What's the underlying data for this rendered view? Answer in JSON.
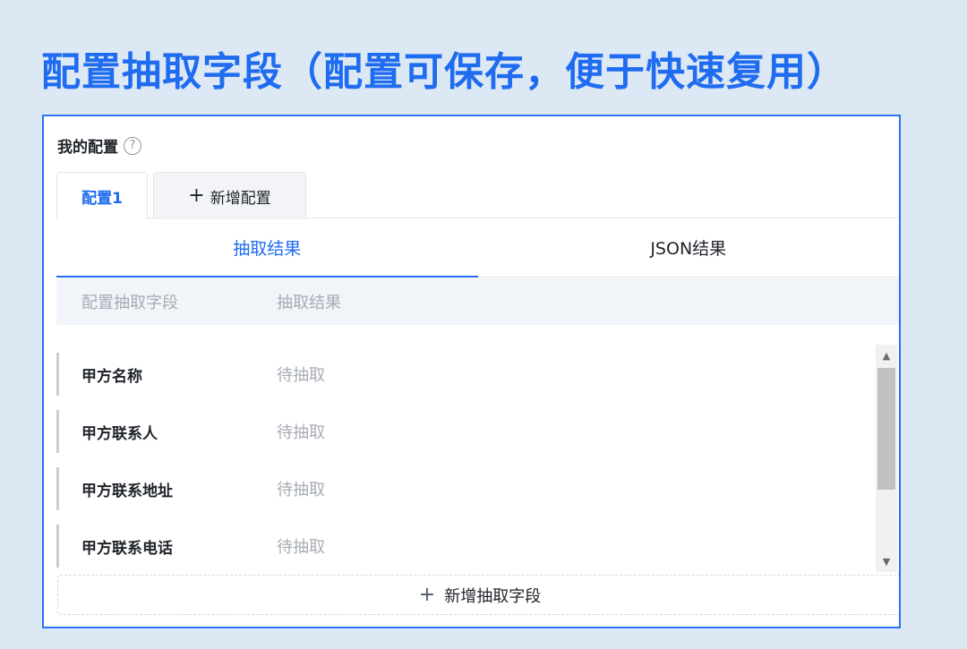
{
  "headline": "配置抽取字段（配置可保存，便于快速复用）",
  "panel": {
    "my_config_label": "我的配置",
    "help_glyph": "?",
    "config_tabs": [
      {
        "label": "配置1",
        "active": true
      },
      {
        "label": "新增配置",
        "icon": "plus-icon"
      }
    ],
    "result_tabs": [
      {
        "label": "抽取结果",
        "active": true
      },
      {
        "label": "JSON结果"
      }
    ],
    "table": {
      "columns": [
        "配置抽取字段",
        "抽取结果"
      ],
      "rows": [
        {
          "field": "甲方名称",
          "value": "待抽取"
        },
        {
          "field": "甲方联系人",
          "value": "待抽取"
        },
        {
          "field": "甲方联系地址",
          "value": "待抽取"
        },
        {
          "field": "甲方联系电话",
          "value": "待抽取"
        }
      ]
    },
    "add_field_label": "新增抽取字段"
  },
  "colors": {
    "accent": "#1f6cf0",
    "background": "#dde8f5",
    "muted_text": "#a7acb4"
  }
}
